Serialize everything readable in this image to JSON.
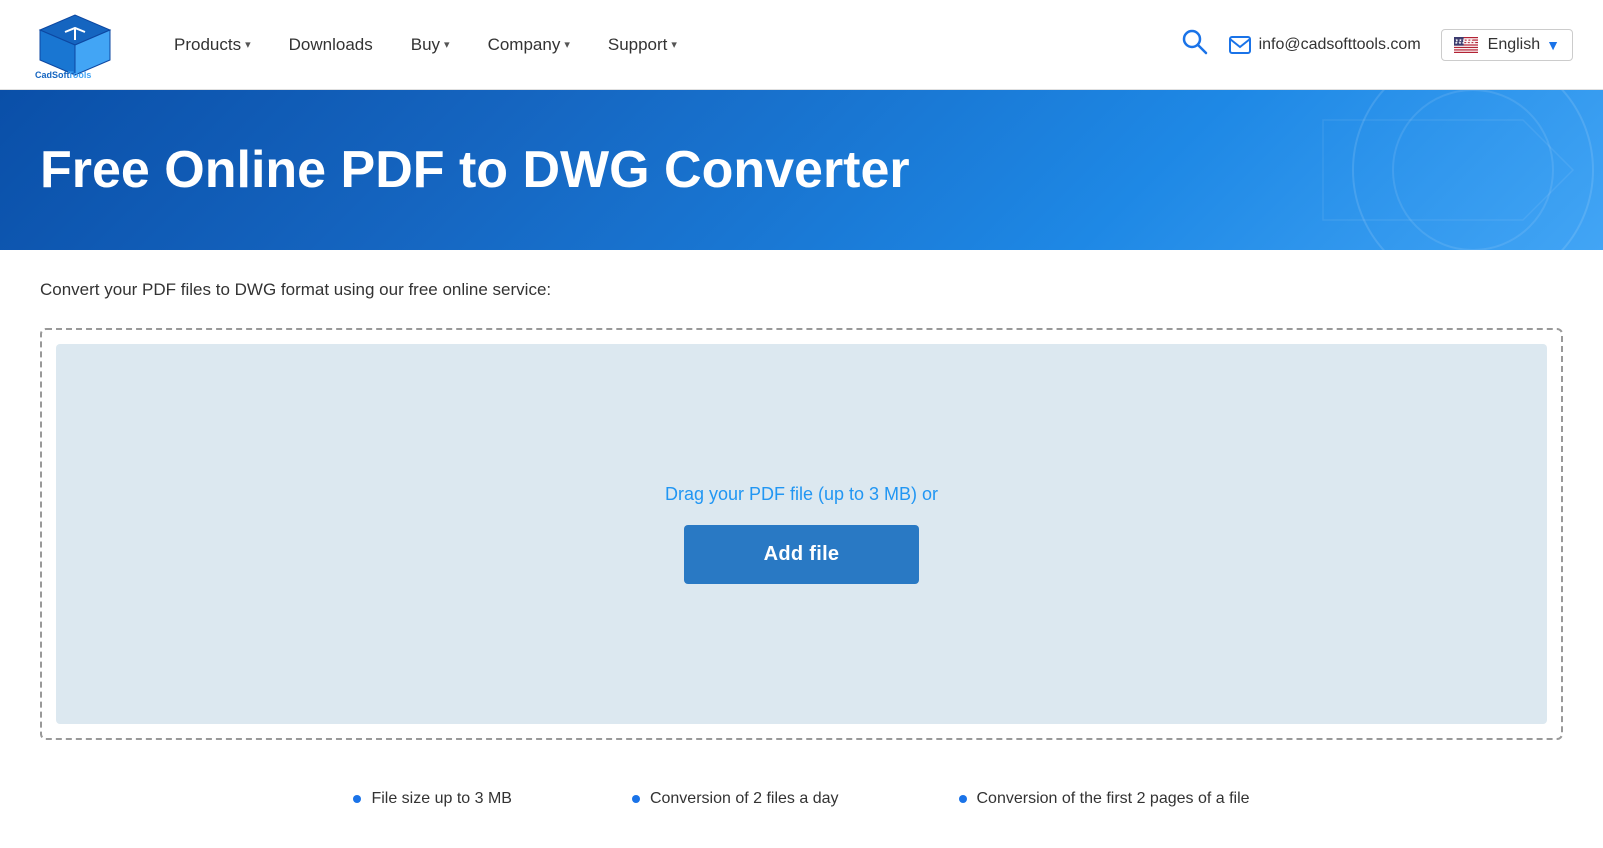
{
  "header": {
    "logo_alt": "CadSoft Tools",
    "nav": [
      {
        "label": "Products",
        "has_dropdown": true
      },
      {
        "label": "Downloads",
        "has_dropdown": false
      },
      {
        "label": "Buy",
        "has_dropdown": true
      },
      {
        "label": "Company",
        "has_dropdown": true
      },
      {
        "label": "Support",
        "has_dropdown": true
      }
    ],
    "email": "info@cadsofttools.com",
    "language": "English",
    "search_label": "Search"
  },
  "hero": {
    "title": "Free Online PDF to DWG Converter"
  },
  "main": {
    "subtitle": "Convert your PDF files to DWG format using our free online service:",
    "drag_text": "Drag your PDF file (up to 3 MB) or",
    "add_file_label": "Add file"
  },
  "features": [
    {
      "text": "File size up to 3 MB"
    },
    {
      "text": "Conversion of 2 files a day"
    },
    {
      "text": "Conversion of the first 2 pages of a file"
    }
  ]
}
